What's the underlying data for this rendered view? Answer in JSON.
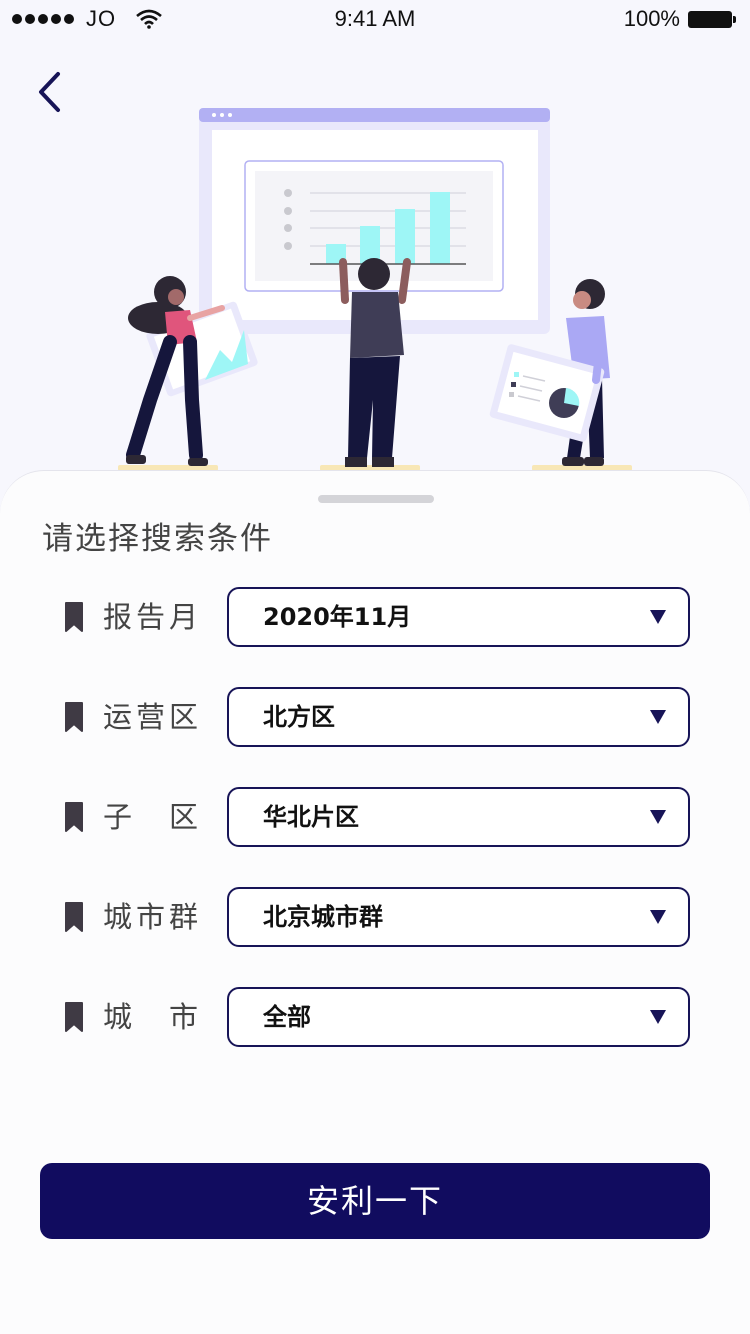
{
  "status_bar": {
    "carrier": "JO",
    "time": "9:41 AM",
    "battery": "100%"
  },
  "icons": {
    "back": "chevron-left-icon",
    "field_marker": "bookmark-icon",
    "dropdown": "triangle-down-icon"
  },
  "colors": {
    "accent": "#110c5f",
    "border": "#171457",
    "illustration_primary": "#b2b0f3",
    "illustration_highlight": "#9ef6f6"
  },
  "sheet": {
    "title": "请选择搜索条件",
    "fields": [
      {
        "label": "报告月",
        "value": "2020年11月"
      },
      {
        "label": "运营区",
        "value": "北方区"
      },
      {
        "label": "子　区",
        "value": "华北片区"
      },
      {
        "label": "城市群",
        "value": "北京城市群"
      },
      {
        "label": "城　市",
        "value": "全部"
      }
    ],
    "submit_label": "安利一下"
  }
}
